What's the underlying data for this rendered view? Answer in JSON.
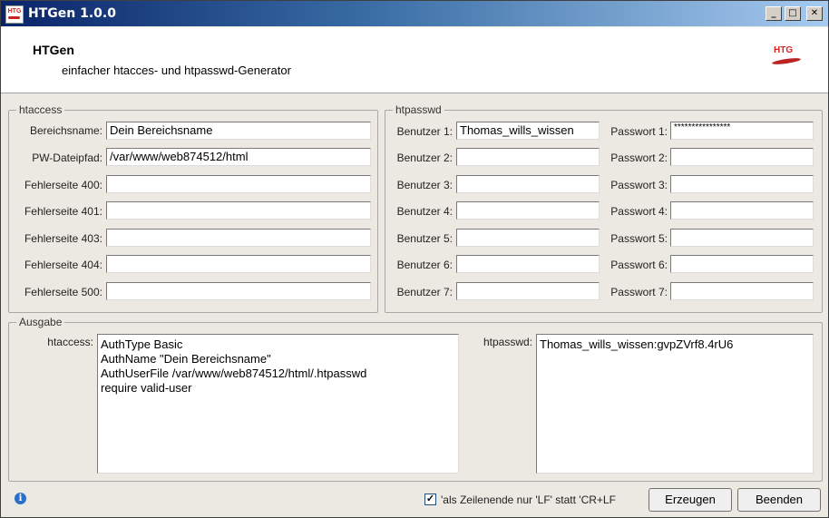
{
  "window": {
    "title": "HTGen 1.0.0",
    "icon": "htg-app-icon"
  },
  "title_buttons": {
    "minimize": "_",
    "maximize": "□",
    "close": "✕"
  },
  "header": {
    "title": "HTGen",
    "subtitle": "einfacher htacces- und htpasswd-Generator",
    "logo_text": "HTG"
  },
  "htaccess": {
    "legend": "htaccess",
    "fields": [
      {
        "label": "Bereichsname:",
        "value": "Dein Bereichsname"
      },
      {
        "label": "PW-Dateipfad:",
        "value": "/var/www/web874512/html"
      },
      {
        "label": "Fehlerseite 400:",
        "value": ""
      },
      {
        "label": "Fehlerseite 401:",
        "value": ""
      },
      {
        "label": "Fehlerseite 403:",
        "value": ""
      },
      {
        "label": "Fehlerseite 404:",
        "value": ""
      },
      {
        "label": "Fehlerseite 500:",
        "value": ""
      }
    ]
  },
  "htpasswd": {
    "legend": "htpasswd",
    "users": [
      {
        "label": "Benutzer 1:",
        "value": "Thomas_wills_wissen"
      },
      {
        "label": "Benutzer 2:",
        "value": ""
      },
      {
        "label": "Benutzer 3:",
        "value": ""
      },
      {
        "label": "Benutzer 4:",
        "value": ""
      },
      {
        "label": "Benutzer 5:",
        "value": ""
      },
      {
        "label": "Benutzer 6:",
        "value": ""
      },
      {
        "label": "Benutzer 7:",
        "value": ""
      }
    ],
    "passwords": [
      {
        "label": "Passwort 1:",
        "value": "****************"
      },
      {
        "label": "Passwort 2:",
        "value": ""
      },
      {
        "label": "Passwort 3:",
        "value": ""
      },
      {
        "label": "Passwort 4:",
        "value": ""
      },
      {
        "label": "Passwort 5:",
        "value": ""
      },
      {
        "label": "Passwort 6:",
        "value": ""
      },
      {
        "label": "Passwort 7:",
        "value": ""
      }
    ]
  },
  "ausgabe": {
    "legend": "Ausgabe",
    "htaccess_label": "htaccess:",
    "htaccess_text": "AuthType Basic\nAuthName \"Dein Bereichsname\"\nAuthUserFile /var/www/web874512/html/.htpasswd\nrequire valid-user",
    "htpasswd_label": "htpasswd:",
    "htpasswd_text": "Thomas_wills_wissen:gvpZVrf8.4rU6"
  },
  "footer": {
    "checkbox_label": "'als Zeilenende nur 'LF' statt 'CR+LF",
    "checkbox_checked": true,
    "checkbox_mark": "✓",
    "info_icon": "i",
    "generate_button": "Erzeugen",
    "exit_button": "Beenden"
  }
}
